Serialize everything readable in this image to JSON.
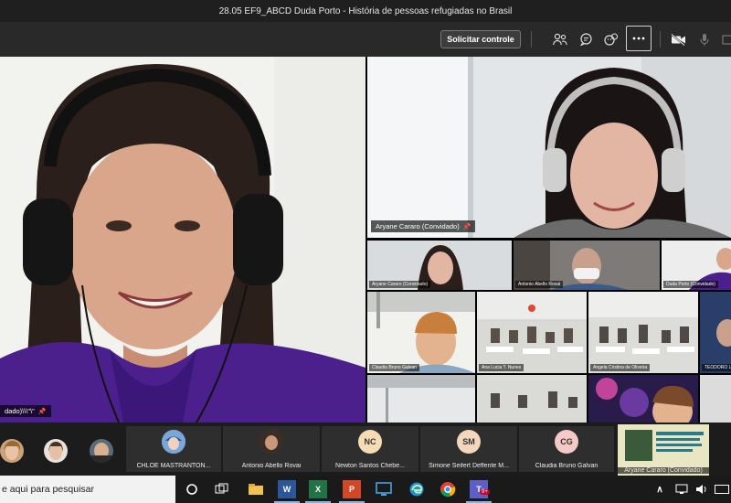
{
  "window": {
    "title": "28.05 EF9_ABCD Duda Porto - História de pessoas refugiadas no Brasil"
  },
  "toolbar": {
    "request_control_label": "Solicitar controle",
    "icons": [
      "participants-icon",
      "chat-icon",
      "reactions-icon",
      "more-actions-icon",
      "camera-off-icon",
      "mic-icon",
      "share-icon"
    ]
  },
  "main_video": {
    "name": "dado)\\\\\\\"\\\""
  },
  "top_right_video": {
    "name": "Aryane Cararo (Convidado)"
  },
  "grid": {
    "row1": [
      "Aryane Cararo (Convidado)",
      "Antonio Abello Rovai",
      "Duda Porto (Convidado)"
    ],
    "row2": [
      "Claudia Bruno Galvan",
      "Ana Lucia T. Nunes",
      "Angela Cristina de Oliveira",
      "TEODORO L"
    ],
    "row3": [
      "",
      "",
      "",
      ""
    ]
  },
  "strip": {
    "cards": [
      {
        "name": "CHLOE MASTRANTON...",
        "initials": "",
        "color": "#8fb4e0"
      },
      {
        "name": "Antonio Abello Rovai",
        "initials": "",
        "color": "#6b4a3a"
      },
      {
        "name": "Newton Santos Chebe...",
        "initials": "NC",
        "color": "#f6dcb4"
      },
      {
        "name": "Simone Seifert Deffente M...",
        "initials": "SM",
        "color": "#f3d6bb"
      },
      {
        "name": "Claudia Bruno Galvan",
        "initials": "CG",
        "color": "#f4c9c6"
      }
    ],
    "thumb_label": "Aryane Cararo (Convidado)"
  },
  "taskbar": {
    "search_placeholder": "e aqui para pesquisar",
    "apps": [
      "cortana-icon",
      "task-view-icon",
      "file-explorer-icon",
      "word-icon",
      "excel-icon",
      "powerpoint-icon",
      "remote-desktop-icon",
      "edge-icon",
      "chrome-icon",
      "teams-icon"
    ],
    "teams_badge": "9+"
  }
}
